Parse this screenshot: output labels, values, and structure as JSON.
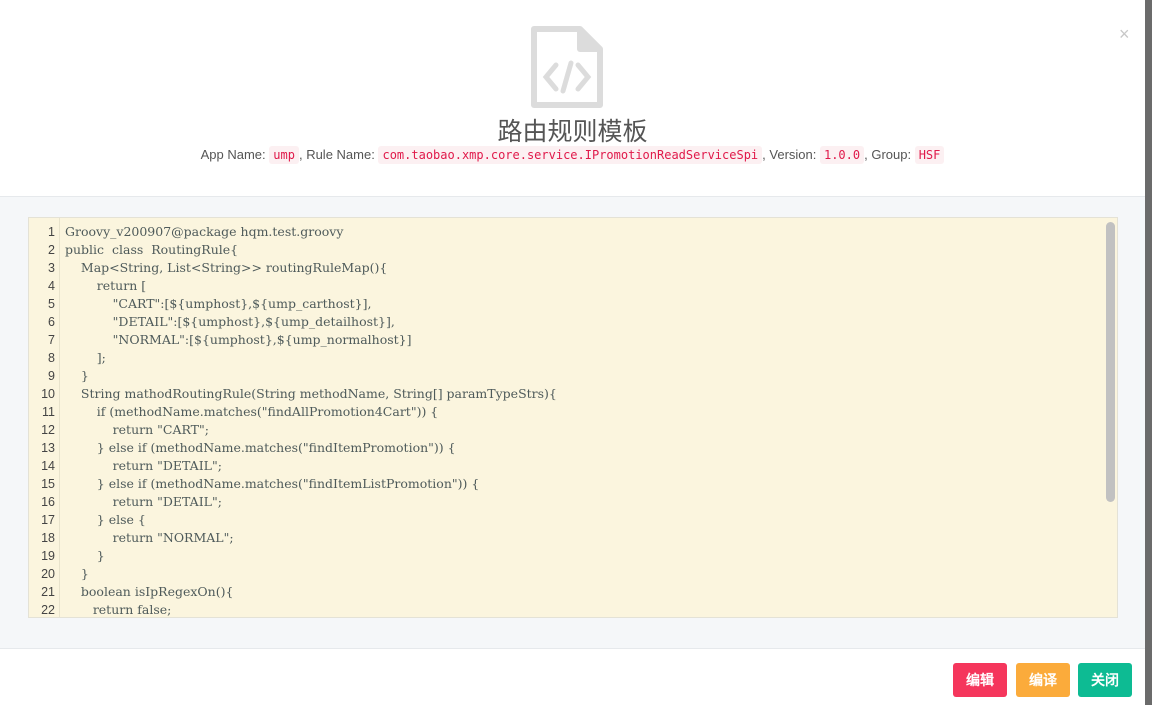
{
  "dialog": {
    "title": "路由规则模板",
    "close_icon": "×",
    "info": {
      "app_label": "App Name:",
      "app": "ump",
      "rule_label": ", Rule Name:",
      "rule": "com.taobao.xmp.core.service.IPromotionReadServiceSpi",
      "version_label": ", Version:",
      "version": "1.0.0",
      "group_label": ", Group:",
      "group": "HSF"
    }
  },
  "code_lines": [
    "Groovy_v200907@package hqm.test.groovy",
    "public  class  RoutingRule{",
    "    Map<String, List<String>> routingRuleMap(){",
    "        return [",
    "            \"CART\":[${umphost},${ump_carthost}],",
    "            \"DETAIL\":[${umphost},${ump_detailhost}],",
    "            \"NORMAL\":[${umphost},${ump_normalhost}]",
    "        ];",
    "    }",
    "    String mathodRoutingRule(String methodName, String[] paramTypeStrs){",
    "        if (methodName.matches(\"findAllPromotion4Cart\")) {",
    "            return \"CART\";",
    "        } else if (methodName.matches(\"findItemPromotion\")) {",
    "            return \"DETAIL\";",
    "        } else if (methodName.matches(\"findItemListPromotion\")) {",
    "            return \"DETAIL\";",
    "        } else {",
    "            return \"NORMAL\";",
    "        }",
    "    }",
    "    boolean isIpRegexOn(){",
    "       return false;"
  ],
  "footer": {
    "edit": "编辑",
    "compile": "编译",
    "close": "关闭"
  },
  "colors": {
    "edit": "#f5365c",
    "compile": "#fbab3b",
    "close": "#0dbb93"
  }
}
